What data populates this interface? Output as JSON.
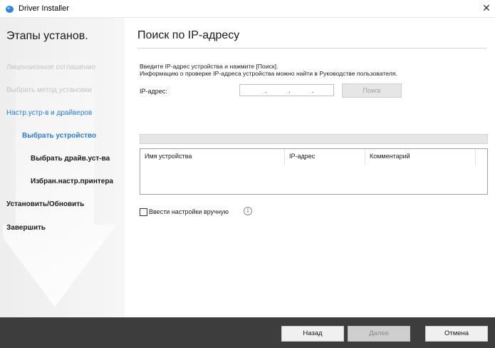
{
  "window": {
    "title": "Driver Installer",
    "icon": "app-droplet-icon",
    "close_glyph": "✕"
  },
  "sidebar": {
    "title": "Этапы установ.",
    "steps": [
      {
        "label": "Лицензионное соглашение",
        "state": "done"
      },
      {
        "label": "Выбрать метод установки",
        "state": "done"
      },
      {
        "label": "Настр.устр-в и драйверов",
        "state": "current"
      },
      {
        "label": "Выбрать устройство",
        "state": "active"
      },
      {
        "label": "Выбрать драйв.уст-ва",
        "state": "pending"
      },
      {
        "label": "Избран.настр.принтера",
        "state": "pending"
      },
      {
        "label": "Установить/Обновить",
        "state": "pending"
      },
      {
        "label": "Завершить",
        "state": "pending"
      }
    ]
  },
  "main": {
    "title": "Поиск по IP-адресу",
    "instruction_line1": "Введите IP-адрес устройства и нажмите [Поиск].",
    "instruction_line2": "Информацию о проверке IP-адреса устройства можно найти в Руководстве пользователя.",
    "ip_label": "IP-адрес:",
    "ip_separator": ".",
    "search_button": "Поиск",
    "table_headers": [
      "Имя устройства",
      "IP-адрес",
      "Комментарий"
    ],
    "manual_checkbox_label": "Ввести настройки вручную",
    "manual_checked": false,
    "info_glyph": "i"
  },
  "footer": {
    "back_button": "Назад",
    "next_button": "Далее",
    "cancel_button": "Отмена"
  },
  "colors": {
    "accent": "#2a7bd0",
    "footer_bg": "#3d3d3d",
    "done_text": "#c4c4c4"
  }
}
